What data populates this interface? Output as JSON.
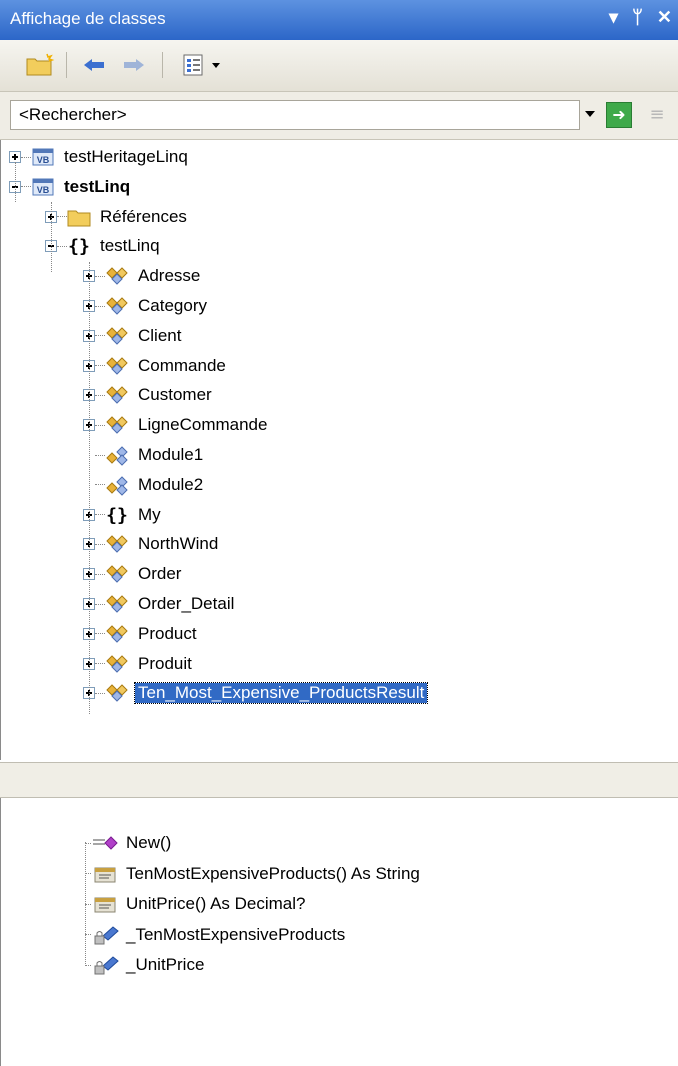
{
  "window": {
    "title": "Affichage de classes",
    "controls": [
      "▾",
      "ᛘ",
      "✕"
    ]
  },
  "search": {
    "value": "<Rechercher>"
  },
  "tree": [
    {
      "label": "testHeritageLinq",
      "icon": "vb-project-icon",
      "expander": "plus",
      "level": 0
    },
    {
      "label": "testLinq",
      "icon": "vb-project-icon",
      "expander": "minus",
      "level": 0,
      "bold": true
    },
    {
      "label": "Références",
      "icon": "folder-icon",
      "expander": "plus",
      "level": 1
    },
    {
      "label": "testLinq",
      "icon": "namespace-icon",
      "expander": "minus",
      "level": 1
    },
    {
      "label": "Adresse",
      "icon": "class-icon",
      "expander": "plus",
      "level": 2
    },
    {
      "label": "Category",
      "icon": "class-icon",
      "expander": "plus",
      "level": 2
    },
    {
      "label": "Client",
      "icon": "class-icon",
      "expander": "plus",
      "level": 2
    },
    {
      "label": "Commande",
      "icon": "class-icon",
      "expander": "plus",
      "level": 2
    },
    {
      "label": "Customer",
      "icon": "class-icon",
      "expander": "plus",
      "level": 2
    },
    {
      "label": "LigneCommande",
      "icon": "class-icon",
      "expander": "plus",
      "level": 2
    },
    {
      "label": "Module1",
      "icon": "module-icon",
      "expander": "none",
      "level": 2
    },
    {
      "label": "Module2",
      "icon": "module-icon",
      "expander": "none",
      "level": 2
    },
    {
      "label": "My",
      "icon": "namespace-icon",
      "expander": "plus",
      "level": 2
    },
    {
      "label": "NorthWind",
      "icon": "class-icon",
      "expander": "plus",
      "level": 2
    },
    {
      "label": "Order",
      "icon": "class-icon",
      "expander": "plus",
      "level": 2
    },
    {
      "label": "Order_Detail",
      "icon": "class-icon",
      "expander": "plus",
      "level": 2
    },
    {
      "label": "Product",
      "icon": "class-icon",
      "expander": "plus",
      "level": 2
    },
    {
      "label": "Produit",
      "icon": "class-icon",
      "expander": "plus",
      "level": 2
    },
    {
      "label": "Ten_Most_Expensive_ProductsResult",
      "icon": "class-icon",
      "expander": "plus",
      "level": 2,
      "selected": true
    }
  ],
  "members": [
    {
      "label": "New()",
      "icon": "method-icon"
    },
    {
      "label": "TenMostExpensiveProducts() As String",
      "icon": "property-icon"
    },
    {
      "label": "UnitPrice() As Decimal?",
      "icon": "property-icon"
    },
    {
      "label": "_TenMostExpensiveProducts",
      "icon": "private-field-icon"
    },
    {
      "label": "_UnitPrice",
      "icon": "private-field-icon"
    }
  ],
  "colors": {
    "title_bar": "#2c66c8",
    "selection": "#316ac5",
    "folder": "#f2cd5c",
    "class_icon": "#e8b23a",
    "method_icon": "#b040c8"
  }
}
